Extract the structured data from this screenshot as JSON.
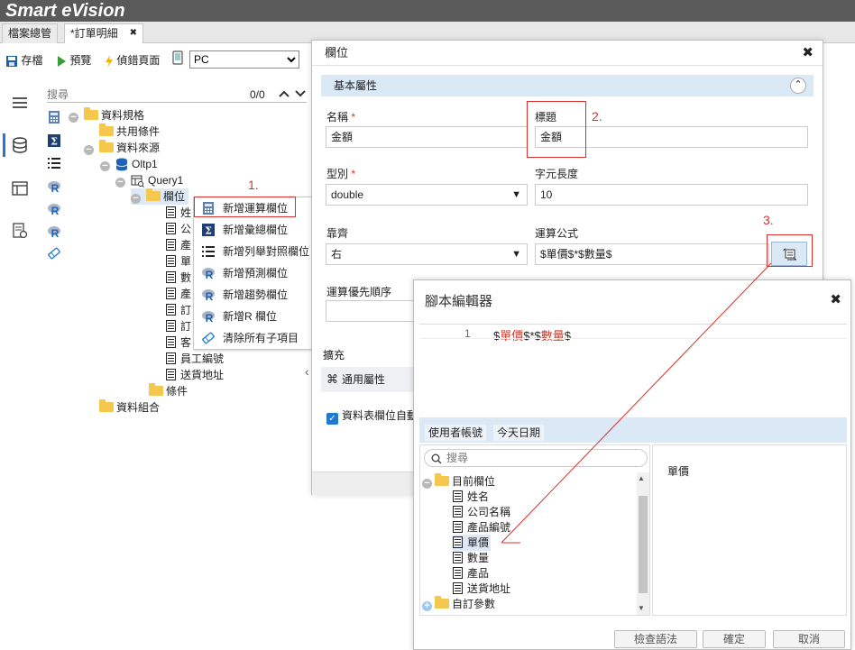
{
  "app": {
    "title": "Smart eVision"
  },
  "tabs": [
    {
      "label": "檔案總管"
    },
    {
      "label": "*訂單明細",
      "close": "✖"
    }
  ],
  "toolbar": {
    "save": "存檔",
    "preview": "預覽",
    "debug": "偵錯頁面",
    "device_value": "PC",
    "device_options": [
      "PC"
    ]
  },
  "search": {
    "placeholder": "搜尋",
    "count": "0/0"
  },
  "tree": {
    "data_spec": "資料規格",
    "shared_conditions": "共用條件",
    "data_source": "資料來源",
    "oltp": "Oltp1",
    "query": "Query1",
    "fields": "欄位",
    "field_items": [
      "姓",
      "公",
      "產",
      "單",
      "數",
      "產",
      "訂",
      "訂",
      "客",
      "員工編號",
      "送貨地址"
    ],
    "conditions": "條件",
    "data_combo": "資料組合"
  },
  "context_menu": {
    "items": [
      "新增運算欄位",
      "新增彙總欄位",
      "新增列舉對照欄位",
      "新增預測欄位",
      "新增趨勢欄位",
      "新增R 欄位",
      "清除所有子項目"
    ]
  },
  "annotations": {
    "step1": "1.",
    "step2": "2.",
    "step3": "3."
  },
  "field_dialog": {
    "title": "欄位",
    "section_basic": "基本屬性",
    "name_label": "名稱",
    "name_value": "金額",
    "caption_label": "標題",
    "caption_value": "金額",
    "type_label": "型別",
    "type_value": "double",
    "length_label": "字元長度",
    "length_value": "10",
    "align_label": "靠齊",
    "align_value": "右",
    "formula_label": "運算公式",
    "formula_value": "$單價$*$數量$",
    "priority_label": "運算優先順序",
    "expand_label": "擴充",
    "general_section": "通用屬性",
    "checkbox_label": "資料表欄位自動"
  },
  "script_editor": {
    "title": "腳本編輯器",
    "line_no": "1",
    "code_parts": [
      "$",
      "單價",
      "$*$",
      "數量",
      "$"
    ],
    "buttons_vars": [
      "使用者帳號",
      "今天日期"
    ],
    "search_placeholder": "搜尋",
    "tree_root": "目前欄位",
    "tree_items": [
      "姓名",
      "公司名稱",
      "產品編號",
      "單價",
      "數量",
      "產品",
      "送貨地址"
    ],
    "tree_custom": "自訂參數",
    "preview_text": "單價",
    "btn_check": "檢查語法",
    "btn_ok": "確定",
    "btn_cancel": "取消"
  },
  "colors": {
    "annotation": "#d9302c",
    "section_bg": "#dbe8f6",
    "titlebar": "#5a5a5a",
    "code_red": "#c0392b"
  }
}
